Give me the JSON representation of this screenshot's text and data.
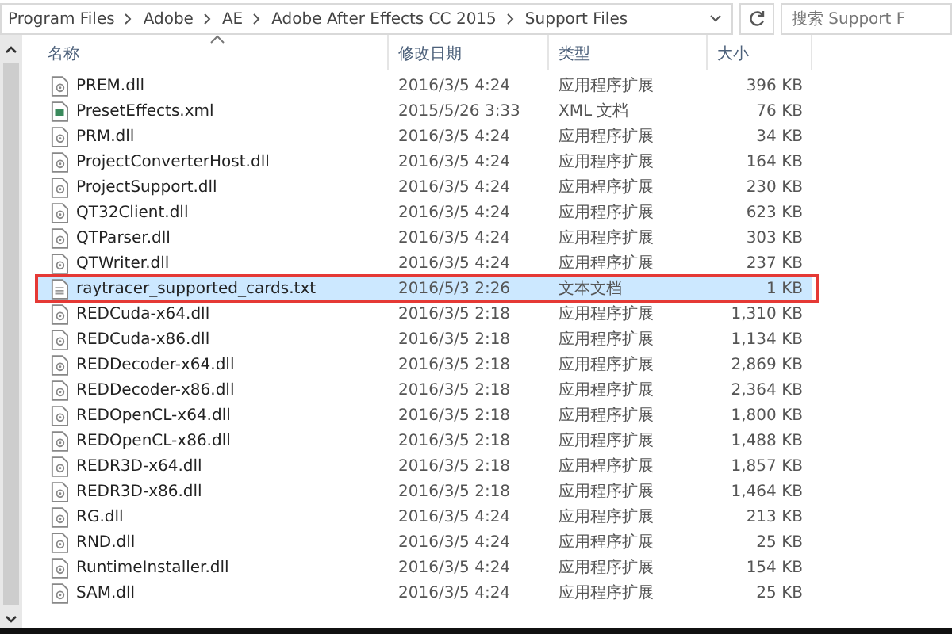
{
  "address_bar": {
    "crumbs": [
      "Program Files",
      "Adobe",
      "AE",
      "Adobe After Effects CC 2015",
      "Support Files"
    ]
  },
  "search": {
    "placeholder": "搜索 Support F"
  },
  "table": {
    "columns": [
      {
        "label": "名称",
        "sorted": true
      },
      {
        "label": "修改日期",
        "sorted": false
      },
      {
        "label": "类型",
        "sorted": false
      },
      {
        "label": "大小",
        "sorted": false
      }
    ],
    "rows": [
      {
        "name": "PREM.dll",
        "date": "2016/3/5 4:24",
        "type": "应用程序扩展",
        "size": "396 KB",
        "kind": "dll",
        "selected": false
      },
      {
        "name": "PresetEffects.xml",
        "date": "2015/5/26 3:33",
        "type": "XML 文档",
        "size": "76 KB",
        "kind": "xml",
        "selected": false
      },
      {
        "name": "PRM.dll",
        "date": "2016/3/5 4:24",
        "type": "应用程序扩展",
        "size": "34 KB",
        "kind": "dll",
        "selected": false
      },
      {
        "name": "ProjectConverterHost.dll",
        "date": "2016/3/5 4:24",
        "type": "应用程序扩展",
        "size": "164 KB",
        "kind": "dll",
        "selected": false
      },
      {
        "name": "ProjectSupport.dll",
        "date": "2016/3/5 4:24",
        "type": "应用程序扩展",
        "size": "230 KB",
        "kind": "dll",
        "selected": false
      },
      {
        "name": "QT32Client.dll",
        "date": "2016/3/5 4:24",
        "type": "应用程序扩展",
        "size": "623 KB",
        "kind": "dll",
        "selected": false
      },
      {
        "name": "QTParser.dll",
        "date": "2016/3/5 4:24",
        "type": "应用程序扩展",
        "size": "303 KB",
        "kind": "dll",
        "selected": false
      },
      {
        "name": "QTWriter.dll",
        "date": "2016/3/5 4:24",
        "type": "应用程序扩展",
        "size": "237 KB",
        "kind": "dll",
        "selected": false
      },
      {
        "name": "raytracer_supported_cards.txt",
        "date": "2016/5/3 2:26",
        "type": "文本文档",
        "size": "1 KB",
        "kind": "txt",
        "selected": true
      },
      {
        "name": "REDCuda-x64.dll",
        "date": "2016/3/5 2:18",
        "type": "应用程序扩展",
        "size": "1,310 KB",
        "kind": "dll",
        "selected": false
      },
      {
        "name": "REDCuda-x86.dll",
        "date": "2016/3/5 2:18",
        "type": "应用程序扩展",
        "size": "1,134 KB",
        "kind": "dll",
        "selected": false
      },
      {
        "name": "REDDecoder-x64.dll",
        "date": "2016/3/5 2:18",
        "type": "应用程序扩展",
        "size": "2,869 KB",
        "kind": "dll",
        "selected": false
      },
      {
        "name": "REDDecoder-x86.dll",
        "date": "2016/3/5 2:18",
        "type": "应用程序扩展",
        "size": "2,364 KB",
        "kind": "dll",
        "selected": false
      },
      {
        "name": "REDOpenCL-x64.dll",
        "date": "2016/3/5 2:18",
        "type": "应用程序扩展",
        "size": "1,800 KB",
        "kind": "dll",
        "selected": false
      },
      {
        "name": "REDOpenCL-x86.dll",
        "date": "2016/3/5 2:18",
        "type": "应用程序扩展",
        "size": "1,488 KB",
        "kind": "dll",
        "selected": false
      },
      {
        "name": "REDR3D-x64.dll",
        "date": "2016/3/5 2:18",
        "type": "应用程序扩展",
        "size": "1,857 KB",
        "kind": "dll",
        "selected": false
      },
      {
        "name": "REDR3D-x86.dll",
        "date": "2016/3/5 2:18",
        "type": "应用程序扩展",
        "size": "1,464 KB",
        "kind": "dll",
        "selected": false
      },
      {
        "name": "RG.dll",
        "date": "2016/3/5 4:24",
        "type": "应用程序扩展",
        "size": "213 KB",
        "kind": "dll",
        "selected": false
      },
      {
        "name": "RND.dll",
        "date": "2016/3/5 4:24",
        "type": "应用程序扩展",
        "size": "25 KB",
        "kind": "dll",
        "selected": false
      },
      {
        "name": "RuntimeInstaller.dll",
        "date": "2016/3/5 4:24",
        "type": "应用程序扩展",
        "size": "154 KB",
        "kind": "dll",
        "selected": false
      },
      {
        "name": "SAM.dll",
        "date": "2016/3/5 4:24",
        "type": "应用程序扩展",
        "size": "25 KB",
        "kind": "dll",
        "selected": false
      }
    ]
  }
}
